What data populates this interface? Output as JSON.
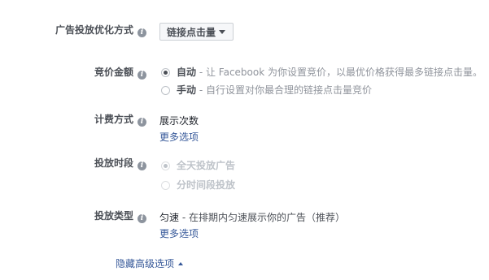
{
  "optimization": {
    "label": "广告投放优化方式",
    "dropdown_value": "链接点击量"
  },
  "bidding": {
    "label": "竞价金额",
    "options": [
      {
        "title": "自动",
        "desc": " - 让 Facebook 为你设置竞价，以最优价格获得最多链接点击量。",
        "checked": true
      },
      {
        "title": "手动",
        "desc": " - 自行设置对你最合理的链接点击量竞价",
        "checked": false
      }
    ]
  },
  "billing": {
    "label": "计费方式",
    "value": "展示次数",
    "more_link": "更多选项"
  },
  "schedule": {
    "label": "投放时段",
    "options": [
      {
        "title": "全天投放广告",
        "checked": true,
        "disabled": true
      },
      {
        "title": "分时间段投放",
        "checked": false,
        "disabled": true
      }
    ]
  },
  "delivery": {
    "label": "投放类型",
    "value_title": "匀速",
    "value_desc": " - 在排期内匀速展示你的广告（推荐）",
    "more_link": "更多选项"
  },
  "advanced": {
    "toggle_label": "隐藏高级选项"
  },
  "icons": {
    "info": "info-icon",
    "dropdown": "chevron-down-icon",
    "collapse": "chevron-up-icon"
  }
}
